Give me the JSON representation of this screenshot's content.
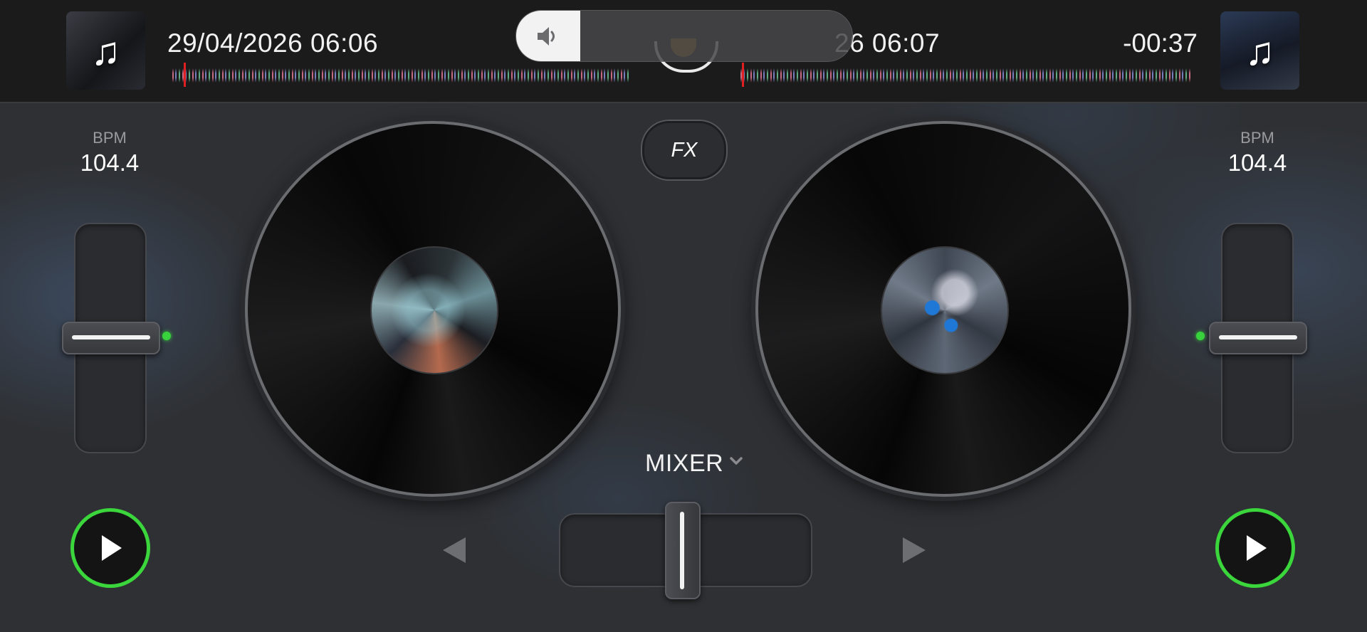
{
  "deck_left": {
    "track_title": "29/04/2026 06:06",
    "bpm_label": "BPM",
    "bpm_value": "104.4",
    "art_icon": "music-note-icon"
  },
  "deck_right": {
    "track_title": "29/04/2026 06:07",
    "track_title_visible": "26 06:07",
    "time_remaining": "-00:37",
    "bpm_label": "BPM",
    "bpm_value": "104.4",
    "art_icon": "music-note-icon"
  },
  "volume_overlay": {
    "icon": "speaker-icon",
    "level": 0.19
  },
  "center": {
    "fx_label": "FX",
    "mixer_label": "MIXER",
    "crossfader_position": 0.5
  },
  "colors": {
    "accent_green": "#3bd53c",
    "playhead_red": "#e02020",
    "background": "#2e3033"
  }
}
